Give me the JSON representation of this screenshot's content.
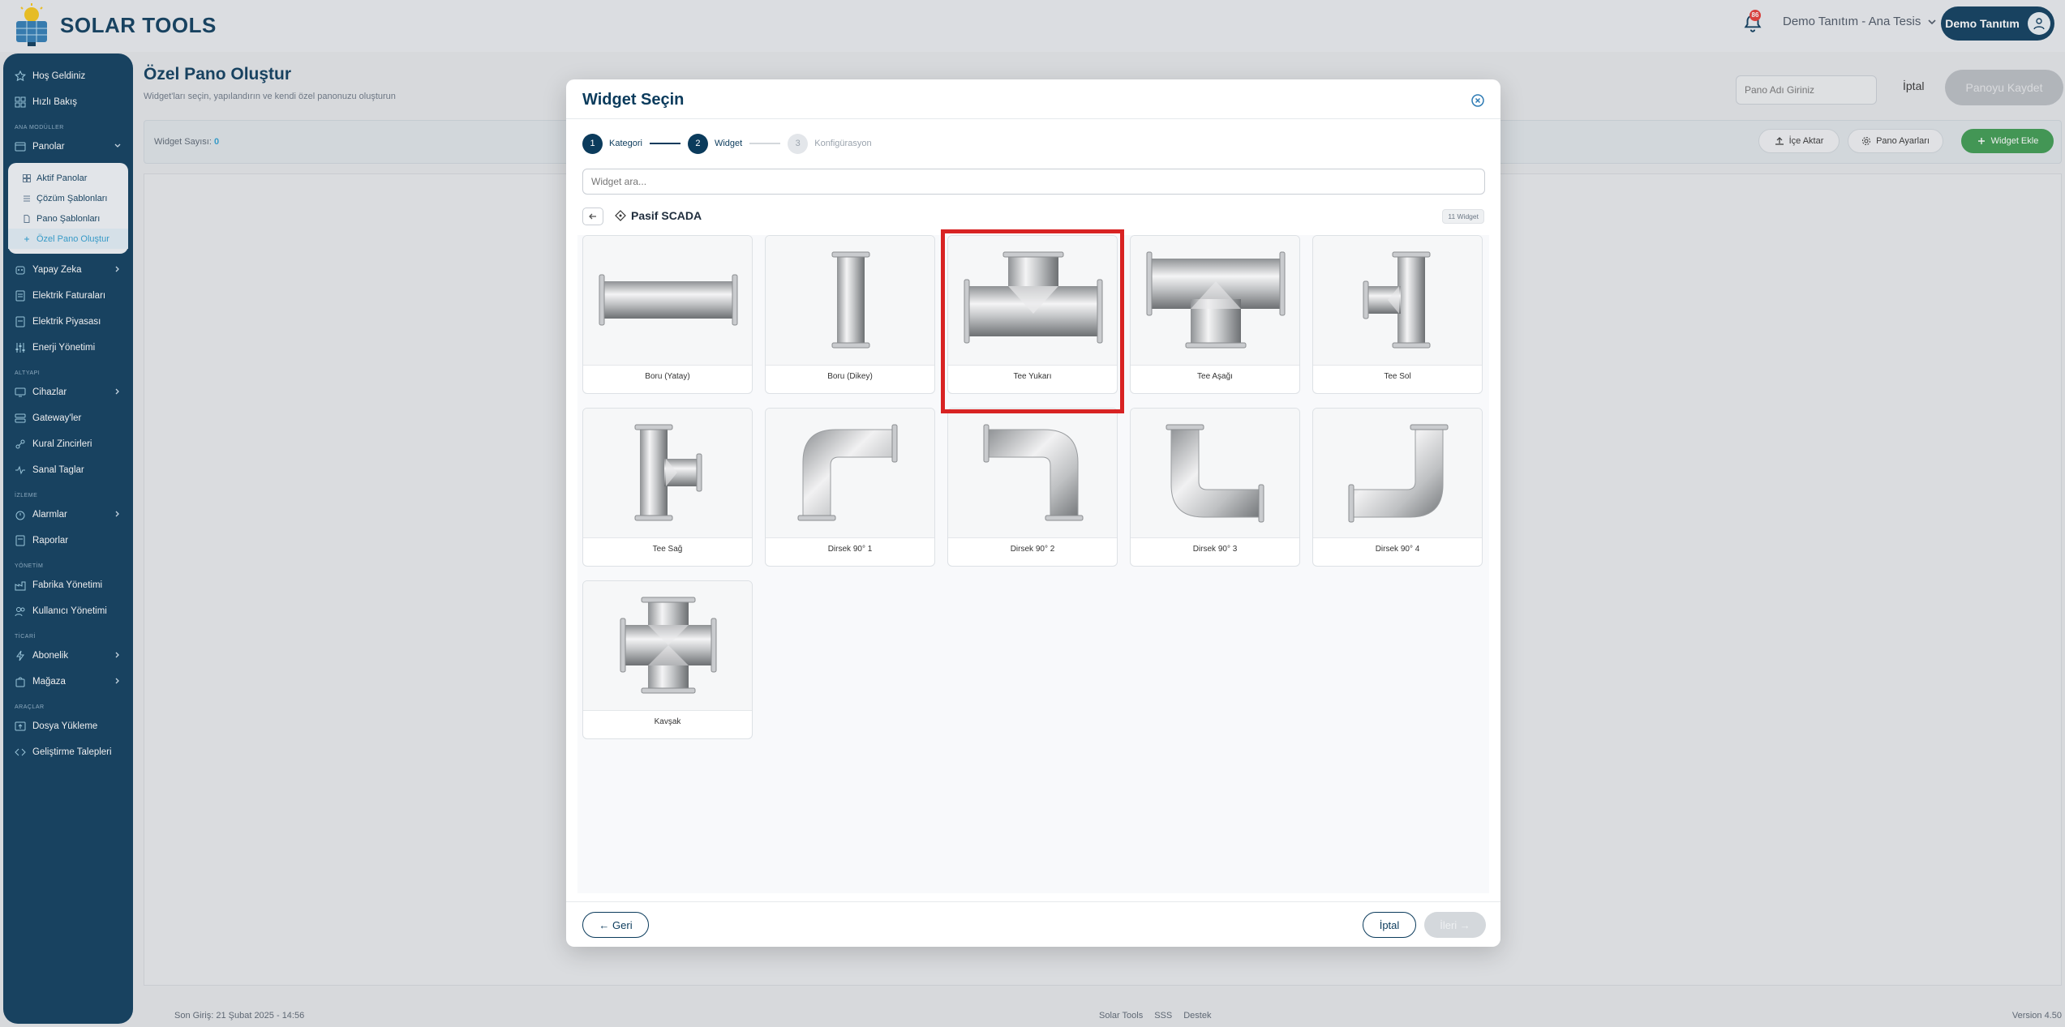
{
  "app": {
    "brand": "SOLAR TOOLS",
    "notification_count": "86"
  },
  "header": {
    "site_selector": "Demo Tanıtım - Ana Tesis",
    "user_name": "Demo Tanıtım"
  },
  "sidebar": {
    "top_items": [
      {
        "label": "Hoş Geldiniz",
        "icon": "star-icon"
      },
      {
        "label": "Hızlı Bakış",
        "icon": "grid-icon"
      }
    ],
    "section_main": "ANA MODÜLLER",
    "panolar": {
      "label": "Panolar",
      "subitems": [
        {
          "label": "Aktif Panolar"
        },
        {
          "label": "Çözüm Şablonları"
        },
        {
          "label": "Pano Şablonları"
        },
        {
          "label": "Özel Pano Oluştur"
        }
      ]
    },
    "main_items": [
      {
        "label": "Yapay Zeka",
        "icon": "ai-icon"
      },
      {
        "label": "Elektrik Faturaları",
        "icon": "invoice-icon"
      },
      {
        "label": "Elektrik Piyasası",
        "icon": "market-icon"
      },
      {
        "label": "Enerji Yönetimi",
        "icon": "sliders-icon"
      }
    ],
    "section_infra": "ALTYAPI",
    "infra_items": [
      {
        "label": "Cihazlar",
        "icon": "monitor-icon"
      },
      {
        "label": "Gateway'ler",
        "icon": "server-icon"
      },
      {
        "label": "Kural Zincirleri",
        "icon": "chain-icon"
      },
      {
        "label": "Sanal Taglar",
        "icon": "pulse-icon"
      }
    ],
    "section_monitor": "İZLEME",
    "monitor_items": [
      {
        "label": "Alarmlar",
        "icon": "alarm-icon"
      },
      {
        "label": "Raporlar",
        "icon": "report-icon"
      }
    ],
    "section_admin": "YÖNETİM",
    "admin_items": [
      {
        "label": "Fabrika Yönetimi",
        "icon": "factory-icon"
      },
      {
        "label": "Kullanıcı Yönetimi",
        "icon": "users-icon"
      }
    ],
    "section_trade": "TİCARİ",
    "trade_items": [
      {
        "label": "Abonelik",
        "icon": "bolt-icon"
      },
      {
        "label": "Mağaza",
        "icon": "shop-icon"
      }
    ],
    "section_tools": "ARAÇLAR",
    "tool_items": [
      {
        "label": "Dosya Yükleme",
        "icon": "upload-icon"
      },
      {
        "label": "Geliştirme Talepleri",
        "icon": "code-icon"
      }
    ]
  },
  "page": {
    "title": "Özel Pano Oluştur",
    "subtitle": "Widget'ları seçin, yapılandırın ve kendi özel panonuzu oluşturun",
    "name_placeholder": "Pano Adı Giriniz",
    "cancel_label": "İptal",
    "save_label": "Panoyu Kaydet",
    "widget_count_label": "Widget Sayısı:",
    "widget_count": "0",
    "import_label": "İçe Aktar",
    "settings_label": "Pano Ayarları",
    "add_widget_label": "Widget Ekle"
  },
  "modal": {
    "title": "Widget Seçin",
    "steps": [
      {
        "num": "1",
        "label": "Kategori"
      },
      {
        "num": "2",
        "label": "Widget"
      },
      {
        "num": "3",
        "label": "Konfigürasyon"
      }
    ],
    "search_placeholder": "Widget ara...",
    "category_name": "Pasif SCADA",
    "category_count": "11 Widget",
    "widgets": [
      {
        "name": "Boru (Yatay)"
      },
      {
        "name": "Boru (Dikey)"
      },
      {
        "name": "Tee Yukarı"
      },
      {
        "name": "Tee Aşağı"
      },
      {
        "name": "Tee Sol"
      },
      {
        "name": "Tee Sağ"
      },
      {
        "name": "Dirsek 90° 1"
      },
      {
        "name": "Dirsek 90° 2"
      },
      {
        "name": "Dirsek 90° 3"
      },
      {
        "name": "Dirsek 90° 4"
      },
      {
        "name": "Kavşak"
      }
    ],
    "back_label": "← Geri",
    "cancel_label": "İptal",
    "next_label": "İleri →"
  },
  "footer": {
    "last_login": "Son Giriş: 21 Şubat 2025 - 14:56",
    "links": [
      "Solar Tools",
      "SSS",
      "Destek"
    ],
    "version": "Version 4.50"
  },
  "colors": {
    "primary": "#0b3b5c",
    "accent": "#2e9fd1",
    "green": "#3c9a4f",
    "highlight": "#d82323"
  }
}
